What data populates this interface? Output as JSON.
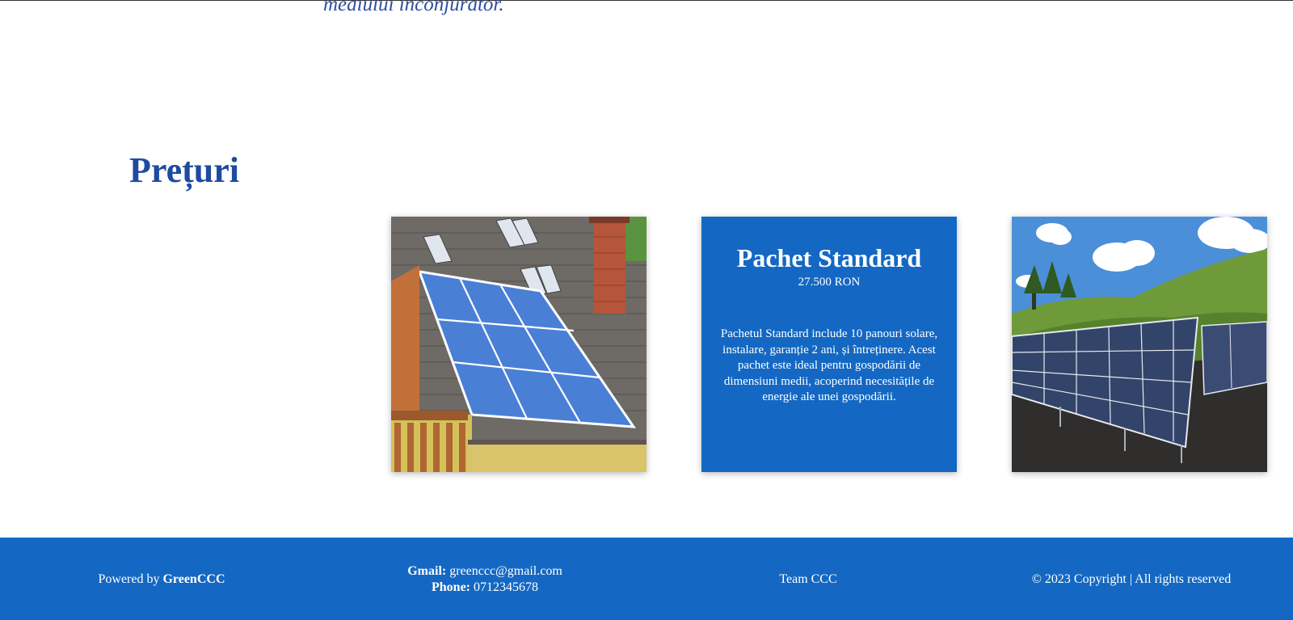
{
  "intro": {
    "tail_text": "mediului înconjurător."
  },
  "pricing": {
    "title": "Prețuri",
    "package": {
      "name": "Pachet Standard",
      "price": "27.500 RON",
      "description": "Pachetul Standard include 10 panouri solare, instalare, garanție 2 ani, și întreținere. Acest pachet este ideal pentru gospodării de dimensiuni medii, acoperind necesitățile de energie ale unei gospodării."
    }
  },
  "footer": {
    "powered_prefix": "Powered by",
    "powered_brand": "GreenCCC",
    "gmail_label": "Gmail:",
    "gmail_value": "greenccc@gmail.com",
    "phone_label": "Phone:",
    "phone_value": "0712345678",
    "team": "Team CCC",
    "copyright": "© 2023 Copyright | All rights reserved"
  },
  "colors": {
    "accent_blue": "#1468c3",
    "heading_blue": "#1e4aa0",
    "text_white": "#ffffff"
  }
}
